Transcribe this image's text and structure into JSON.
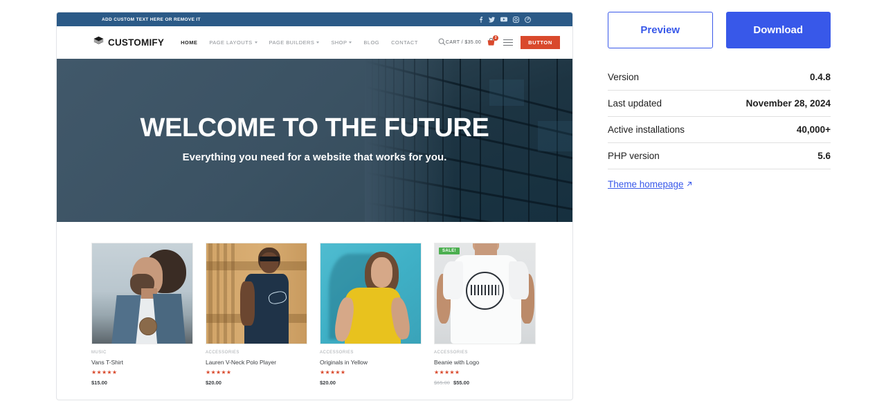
{
  "preview": {
    "topbar": {
      "text": "ADD CUSTOM TEXT HERE OR REMOVE IT",
      "social": [
        {
          "name": "facebook-icon",
          "label": "Facebook"
        },
        {
          "name": "twitter-icon",
          "label": "Twitter"
        },
        {
          "name": "youtube-icon",
          "label": "YouTube"
        },
        {
          "name": "instagram-icon",
          "label": "Instagram"
        },
        {
          "name": "pinterest-icon",
          "label": "Pinterest"
        }
      ]
    },
    "nav": {
      "brand": "CUSTOMIFY",
      "brand_icon": "layers-logo-icon",
      "items": [
        {
          "label": "HOME",
          "dropdown": false,
          "active": true
        },
        {
          "label": "PAGE LAYOUTS",
          "dropdown": true,
          "active": false
        },
        {
          "label": "PAGE BUILDERS",
          "dropdown": true,
          "active": false
        },
        {
          "label": "SHOP",
          "dropdown": true,
          "active": false
        },
        {
          "label": "BLOG",
          "dropdown": false,
          "active": false
        },
        {
          "label": "CONTACT",
          "dropdown": false,
          "active": false
        }
      ],
      "search_icon": "search-icon",
      "cart_label": "CART / $35.00",
      "cart_icon": "shopping-cart-icon",
      "cart_count": "2",
      "menu_icon": "hamburger-icon",
      "button_label": "BUTTON"
    },
    "hero": {
      "title": "WELCOME TO THE FUTURE",
      "subtitle": "Everything you need for a website that works for you."
    },
    "products": [
      {
        "category": "MUSIC",
        "name": "Vans T-Shirt",
        "rating": "★★★★★",
        "price": "$15.00",
        "old_price": "",
        "sale": false,
        "sale_label": "",
        "image_name": "product-photo-man-denim-jacket"
      },
      {
        "category": "ACCESSORIES",
        "name": "Lauren V-Neck Polo Player",
        "rating": "★★★★★",
        "price": "$20.00",
        "old_price": "",
        "sale": false,
        "sale_label": "",
        "image_name": "product-photo-man-navy-tee"
      },
      {
        "category": "ACCESSORIES",
        "name": "Originals in Yellow",
        "rating": "★★★★★",
        "price": "$20.00",
        "old_price": "",
        "sale": false,
        "sale_label": "",
        "image_name": "product-photo-woman-yellow-tee"
      },
      {
        "category": "ACCESSORIES",
        "name": "Beanie with Logo",
        "rating": "★★★★★",
        "price": "$55.00",
        "old_price": "$65.00",
        "sale": true,
        "sale_label": "SALE!",
        "image_name": "product-photo-man-white-legendary-tee"
      }
    ]
  },
  "info": {
    "preview_button": "Preview",
    "download_button": "Download",
    "meta": [
      {
        "label": "Version",
        "value": "0.4.8"
      },
      {
        "label": "Last updated",
        "value": "November 28, 2024"
      },
      {
        "label": "Active installations",
        "value": "40,000+"
      },
      {
        "label": "PHP version",
        "value": "5.6"
      }
    ],
    "homepage_link": "Theme homepage",
    "homepage_icon": "external-link-icon"
  },
  "colors": {
    "topbar": "#2b5a87",
    "accent_button": "#d9492c",
    "wp_blue": "#3858e9",
    "sale_green": "#4caf50",
    "star": "#d9492c"
  }
}
